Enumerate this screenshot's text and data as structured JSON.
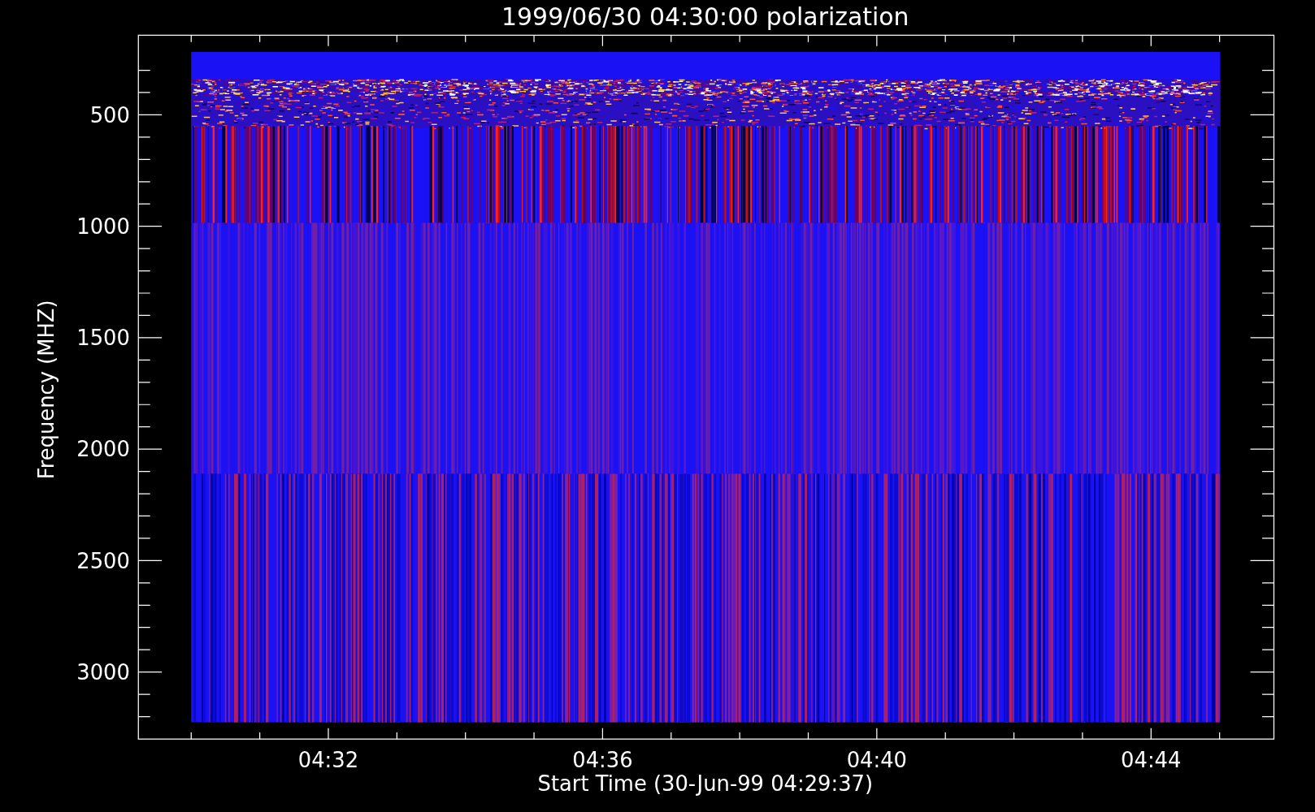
{
  "title": "1999/06/30 04:30:00 polarization",
  "y_axis": {
    "label": "Frequency (MHZ)",
    "ticks": [
      "500",
      "1000",
      "1500",
      "2000",
      "2500",
      "3000"
    ]
  },
  "x_axis": {
    "label": "Start Time (30-Jun-99 04:29:37)",
    "ticks": [
      "04:32",
      "04:36",
      "04:40",
      "04:44"
    ]
  }
}
